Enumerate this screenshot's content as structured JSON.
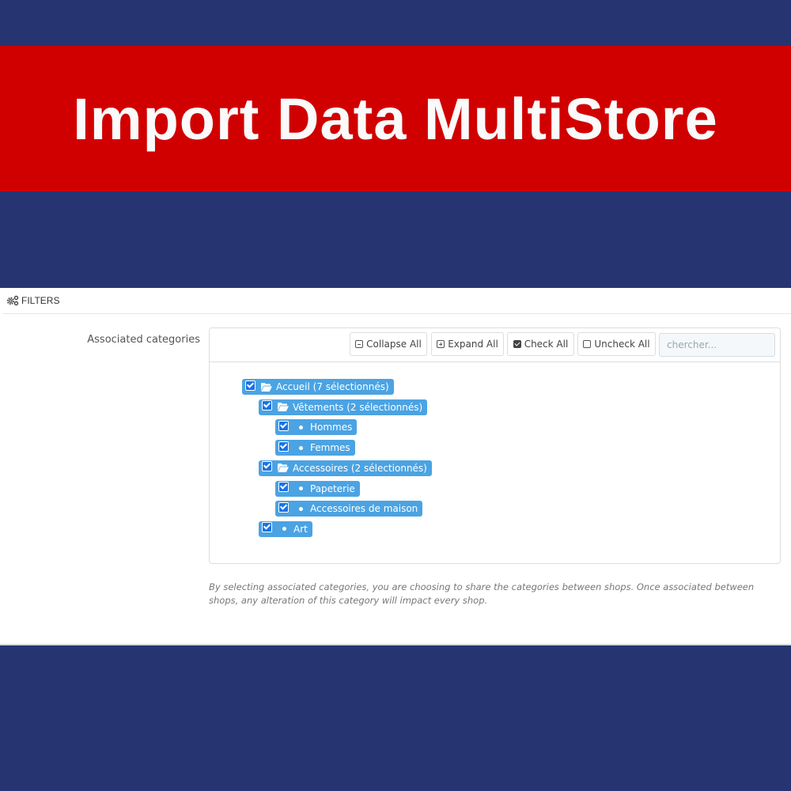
{
  "banner": {
    "title": "Import Data MultiStore"
  },
  "colors": {
    "background": "#263472",
    "banner": "#d10000",
    "node": "#4ba3e3",
    "checkbox": "#1a73e8"
  },
  "panel": {
    "title": "FILTERS",
    "icon": "gears-icon",
    "field_label": "Associated categories",
    "toolbar": {
      "collapse_all": "Collapse All",
      "expand_all": "Expand All",
      "check_all": "Check All",
      "uncheck_all": "Uncheck All",
      "search_placeholder": "chercher..."
    },
    "tree": [
      {
        "label": "Accueil (7 sélectionnés)",
        "type": "folder",
        "level": 0,
        "checked": true
      },
      {
        "label": "Vêtements (2 sélectionnés)",
        "type": "folder",
        "level": 1,
        "checked": true
      },
      {
        "label": "Hommes",
        "type": "leaf",
        "level": 2,
        "checked": true
      },
      {
        "label": "Femmes",
        "type": "leaf",
        "level": 2,
        "checked": true
      },
      {
        "label": "Accessoires (2 sélectionnés)",
        "type": "folder",
        "level": 1,
        "checked": true
      },
      {
        "label": "Papeterie",
        "type": "leaf",
        "level": 2,
        "checked": true
      },
      {
        "label": "Accessoires de maison",
        "type": "leaf",
        "level": 2,
        "checked": true
      },
      {
        "label": "Art",
        "type": "leaf",
        "level": 1,
        "checked": true
      }
    ],
    "help_text": "By selecting associated categories, you are choosing to share the categories between shops. Once associated between shops, any alteration of this category will impact every shop."
  }
}
